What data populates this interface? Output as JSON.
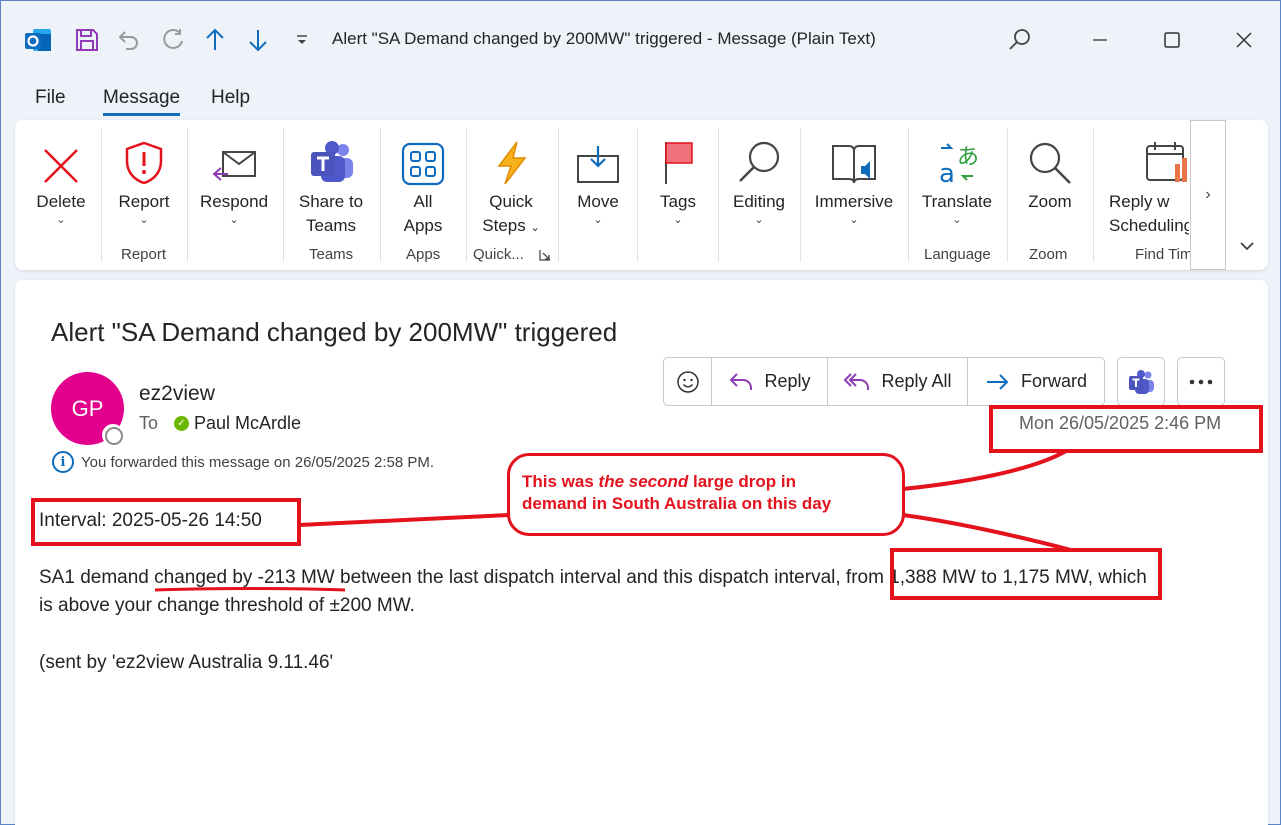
{
  "window": {
    "title": "Alert \"SA Demand changed by 200MW\" triggered  -  Message (Plain Text)"
  },
  "menu": {
    "tabs": [
      {
        "label": "File"
      },
      {
        "label": "Message"
      },
      {
        "label": "Help"
      }
    ],
    "active_tab": "Message"
  },
  "ribbon": {
    "buttons": {
      "delete": "Delete",
      "report": "Report",
      "respond": "Respond",
      "share_line1": "Share to",
      "share_line2": "Teams",
      "allapps_line1": "All",
      "allapps_line2": "Apps",
      "quick_line1": "Quick",
      "quick_line2": "Steps",
      "move": "Move",
      "tags": "Tags",
      "editing": "Editing",
      "immersive": "Immersive",
      "translate": "Translate",
      "zoom": "Zoom",
      "reply_sched_line1": "Reply w",
      "reply_sched_line2": "Scheduling"
    },
    "groups": {
      "report": "Report",
      "teams": "Teams",
      "apps": "Apps",
      "quick": "Quick...",
      "language": "Language",
      "zoom": "Zoom",
      "find_time": "Find Tim"
    }
  },
  "message": {
    "subject": "Alert \"SA Demand changed by 200MW\" triggered",
    "sender": "ez2view",
    "avatar_initials": "GP",
    "to_label": "To",
    "recipient": "Paul McArdle",
    "forward_info": "You forwarded this message on 26/05/2025 2:58 PM.",
    "date": "Mon 26/05/2025 2:46 PM",
    "actions": {
      "reply": "Reply",
      "reply_all": "Reply All",
      "forward": "Forward"
    },
    "body": {
      "interval": "Interval: 2025-05-26 14:50",
      "line1_a": "SA1 demand ",
      "line1_b": "changed by -213 MW",
      "line1_c": " between the last dispatch interval and this dispatch interval, ",
      "line1_d": "from 1,388 MW to 1,175 MW",
      "line1_e": ", which",
      "line2": "is above your change threshold of ±200 MW.",
      "signature": "(sent by 'ez2view Australia 9.11.46'"
    }
  },
  "annotation": {
    "prefix": "This was ",
    "emphasis": "the second",
    "suffix": " large drop in",
    "line2": "demand in South Australia on this day",
    "color": "#e3121d"
  }
}
